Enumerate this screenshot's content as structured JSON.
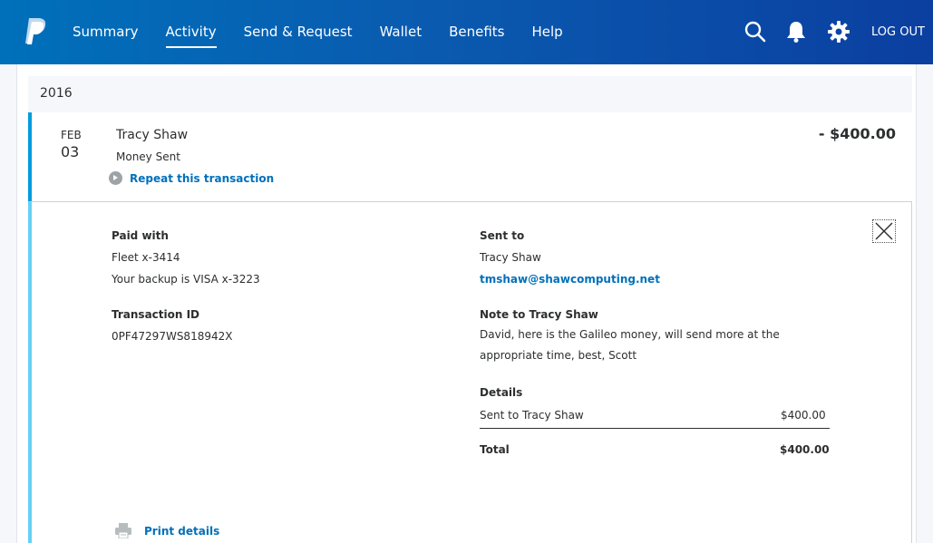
{
  "header": {
    "nav": [
      "Summary",
      "Activity",
      "Send & Request",
      "Wallet",
      "Benefits",
      "Help"
    ],
    "active_index": 1,
    "logout_label": "LOG OUT"
  },
  "activity": {
    "year": "2016",
    "transaction": {
      "month": "FEB",
      "day": "03",
      "name": "Tracy Shaw",
      "type": "Money Sent",
      "repeat_label": "Repeat this transaction",
      "amount": "- $400.00"
    }
  },
  "details": {
    "paid_with_label": "Paid with",
    "paid_with_card": "Fleet x-3414",
    "backup_text": "Your backup is VISA x-3223",
    "transaction_id_label": "Transaction ID",
    "transaction_id": "0PF47297WS818942X",
    "sent_to_label": "Sent to",
    "sent_to_name": "Tracy Shaw",
    "sent_to_email": "tmshaw@shawcomputing.net",
    "note_label": "Note to Tracy Shaw",
    "note_text": "David, here is the Galileo money, will send more at the appropriate time, best, Scott",
    "details_label": "Details",
    "line_item_label": "Sent to Tracy Shaw",
    "line_item_amount": "$400.00",
    "total_label": "Total",
    "total_amount": "$400.00",
    "print_label": "Print details"
  }
}
